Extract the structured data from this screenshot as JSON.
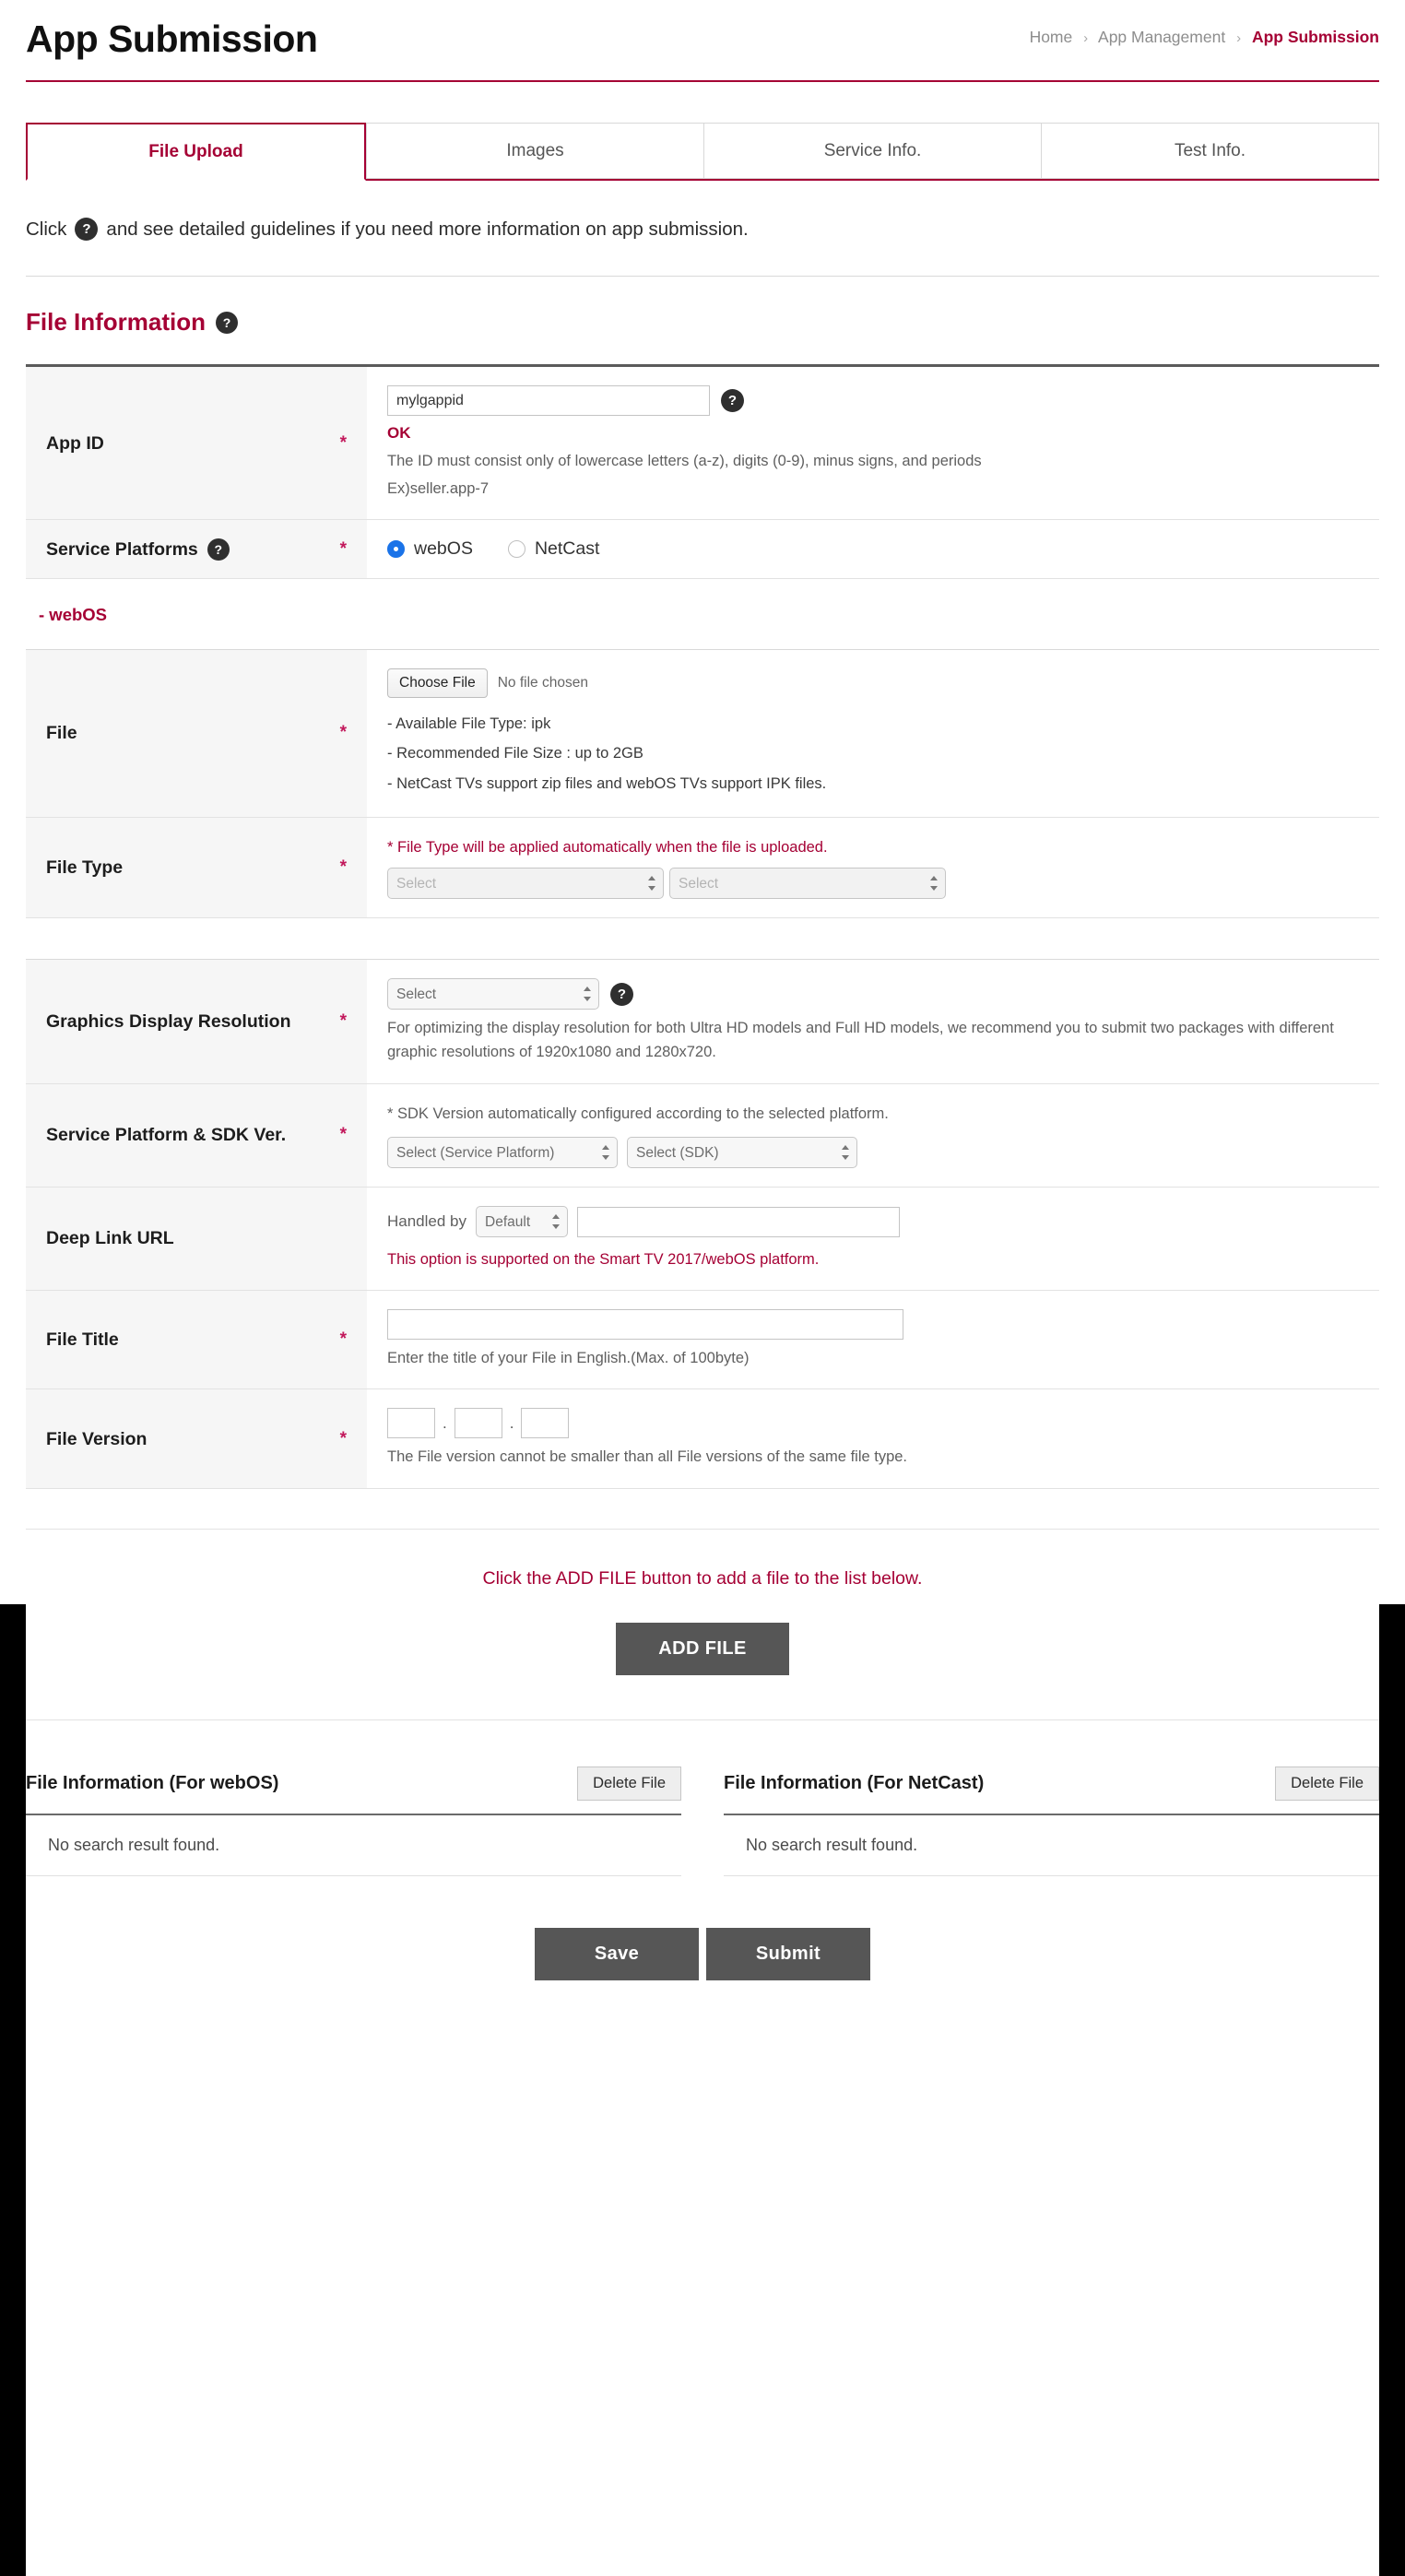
{
  "header": {
    "title": "App Submission",
    "breadcrumb": {
      "home": "Home",
      "sep": "›",
      "section": "App Management",
      "current": "App Submission"
    }
  },
  "tabs": [
    {
      "label": "File Upload",
      "active": true
    },
    {
      "label": "Images",
      "active": false
    },
    {
      "label": "Service Info.",
      "active": false
    },
    {
      "label": "Test Info.",
      "active": false
    }
  ],
  "guideline": {
    "pre": "Click",
    "help_icon": "help-icon",
    "post": "and see detailed guidelines if you need more information on app submission."
  },
  "section": {
    "title": "File Information",
    "help_icon": "help-icon"
  },
  "form": {
    "app_id": {
      "label": "App ID",
      "required": "*",
      "value": "mylgappid",
      "placeholder": "",
      "status": "OK",
      "hint_line1": "The ID must consist only of lowercase letters (a-z), digits (0-9), minus signs, and periods",
      "hint_line2": "Ex)seller.app-7"
    },
    "service_platforms": {
      "label": "Service Platforms",
      "required": "*",
      "options": [
        {
          "label": "webOS",
          "selected": true
        },
        {
          "label": "NetCast",
          "selected": false
        }
      ]
    },
    "webos_subsection": "- webOS",
    "file": {
      "label": "File",
      "required": "*",
      "choose_label": "Choose File",
      "no_file": "No file chosen",
      "bullets": [
        "- Available File Type: ipk",
        "- Recommended File Size : up to 2GB",
        "- NetCast TVs support zip files and webOS TVs support IPK files."
      ]
    },
    "file_type": {
      "label": "File Type",
      "required": "*",
      "note": "* File Type will be applied automatically when the file is uploaded.",
      "select1": "Select",
      "select2": "Select"
    },
    "graphics_resolution": {
      "label": "Graphics Display Resolution",
      "required": "*",
      "select": "Select",
      "hint": "For optimizing the display resolution for both Ultra HD models and Full HD models, we recommend you to submit two packages with different graphic resolutions of 1920x1080 and 1280x720."
    },
    "service_sdk": {
      "label": "Service Platform & SDK Ver.",
      "required": "*",
      "note": "* SDK Version automatically configured according to the selected platform.",
      "select_platform": "Select (Service Platform)",
      "select_sdk": "Select (SDK)"
    },
    "deep_link": {
      "label": "Deep Link URL",
      "handled_by_label": "Handled by",
      "handled_by_value": "Default",
      "url_value": "",
      "note": "This option is supported on the Smart TV 2017/webOS platform."
    },
    "file_title": {
      "label": "File Title",
      "required": "*",
      "value": "",
      "hint": "Enter the title of your File in English.(Max. of 100byte)"
    },
    "file_version": {
      "label": "File Version",
      "required": "*",
      "major": "",
      "minor": "",
      "patch": "",
      "dot": ".",
      "hint": "The File version cannot be smaller than all File versions of the same file type."
    }
  },
  "add_file": {
    "message": "Click the ADD FILE button to add a file to the list below.",
    "button": "ADD FILE"
  },
  "file_lists": [
    {
      "title": "File Information (For webOS)",
      "delete_button": "Delete File",
      "empty_message": "No search result found."
    },
    {
      "title": "File Information (For NetCast)",
      "delete_button": "Delete File",
      "empty_message": "No search result found."
    }
  ],
  "footer": {
    "save": "Save",
    "submit": "Submit"
  },
  "colors": {
    "accent": "#a50034",
    "radio_blue": "#1a73e8",
    "dark_button": "#565656",
    "help_circle": "#2f2f2f"
  }
}
